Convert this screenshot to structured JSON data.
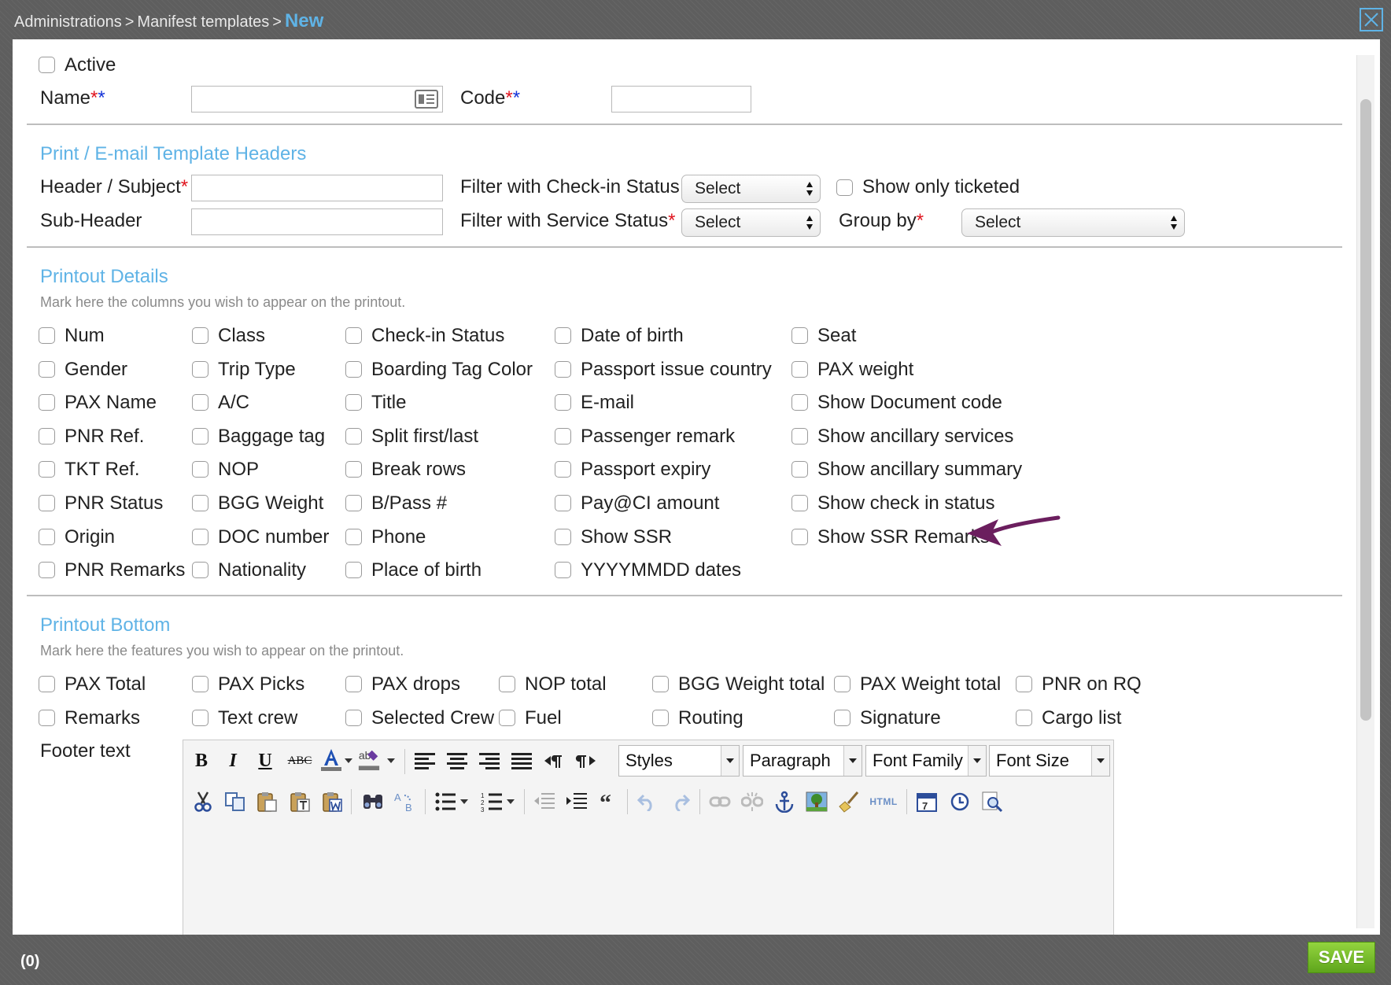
{
  "breadcrumb": {
    "items": [
      "Administrations",
      "Manifest templates"
    ],
    "separator": ">",
    "current": "New"
  },
  "form": {
    "active_label": "Active",
    "name_label": "Name",
    "code_label": "Code",
    "name_value": "",
    "code_value": "",
    "required_mark": "*",
    "required_mark_blue": "*"
  },
  "headers": {
    "title": "Print / E-mail Template Headers",
    "header_subject_label": "Header / Subject",
    "sub_header_label": "Sub-Header",
    "filter_checkin_label": "Filter with Check-in Status",
    "filter_service_label": "Filter with Service Status",
    "group_by_label": "Group by",
    "show_only_ticketed_label": "Show only ticketed",
    "select_checkin": "Select",
    "select_service": "Select",
    "select_group": "Select"
  },
  "details": {
    "title": "Printout Details",
    "hint": "Mark here the columns you wish to appear on the printout.",
    "columns": [
      [
        "Num",
        "Gender",
        "PAX Name",
        "PNR Ref.",
        "TKT Ref.",
        "PNR Status",
        "Origin",
        "PNR Remarks"
      ],
      [
        "Class",
        "Trip Type",
        "A/C",
        "Baggage tag",
        "NOP",
        "BGG Weight",
        "DOC number",
        "Nationality"
      ],
      [
        "Check-in Status",
        "Boarding Tag Color",
        "Title",
        "Split first/last",
        "Break rows",
        "B/Pass #",
        "Phone",
        "Place of birth"
      ],
      [
        "Date of birth",
        "Passport issue country",
        "E-mail",
        "Passenger remark",
        "Passport expiry",
        "Pay@CI amount",
        "Show SSR",
        "YYYYMMDD dates"
      ],
      [
        "Seat",
        "PAX weight",
        "Show Document code",
        "Show ancillary services",
        "Show ancillary summary",
        "Show check in status",
        "Show SSR Remarks"
      ]
    ]
  },
  "bottom": {
    "title": "Printout Bottom",
    "hint": "Mark here the features you wish to appear on the printout.",
    "row1": [
      "PAX Total",
      "PAX Picks",
      "PAX drops",
      "NOP total",
      "BGG Weight total",
      "PAX Weight total",
      "PNR on RQ"
    ],
    "row2": [
      "Remarks",
      "Text crew",
      "Selected Crew",
      "Fuel",
      "Routing",
      "Signature",
      "Cargo list"
    ],
    "footer_label": "Footer text"
  },
  "editor": {
    "styles": "Styles",
    "paragraph": "Paragraph",
    "font_family": "Font Family",
    "font_size": "Font Size",
    "bold": "B",
    "italic": "I",
    "underline": "U",
    "strike": "ABC",
    "html": "HTML",
    "calendar": "7"
  },
  "footer": {
    "count": "(0)",
    "save_label": "SAVE"
  },
  "colors": {
    "accent": "#5fb3e6",
    "required_red": "#e0141e",
    "required_blue": "#1433d8",
    "save_green": "#6cb524",
    "annotation_arrow": "#6b1e5e"
  }
}
